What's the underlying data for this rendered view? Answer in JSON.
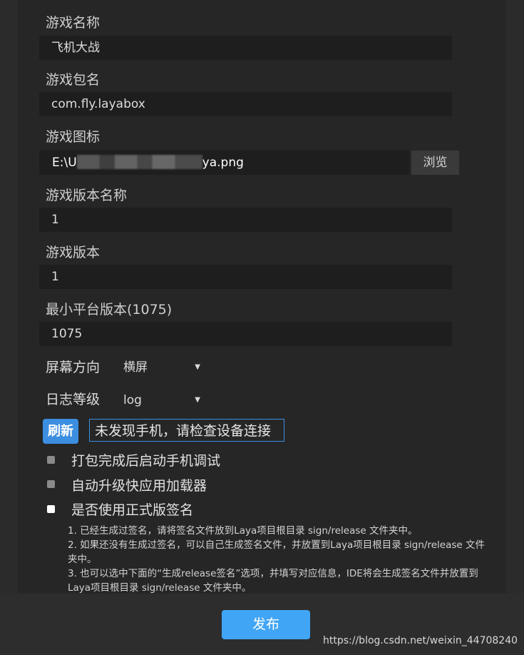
{
  "form": {
    "game_name": {
      "label": "游戏名称",
      "value": "飞机大战"
    },
    "package_name": {
      "label": "游戏包名",
      "value": "com.fly.layabox"
    },
    "game_icon": {
      "label": "游戏图标",
      "value_prefix": "E:\\U",
      "value_suffix": "ya.png",
      "browse_label": "浏览"
    },
    "version_name": {
      "label": "游戏版本名称",
      "value": "1"
    },
    "version_code": {
      "label": "游戏版本",
      "value": "1"
    },
    "min_platform_version": {
      "label": "最小平台版本(1075)",
      "value": "1075"
    },
    "orientation": {
      "label": "屏幕方向",
      "selected": "横屏"
    },
    "log_level": {
      "label": "日志等级",
      "selected": "log"
    }
  },
  "device": {
    "refresh_label": "刷新",
    "status": "未发现手机，请检查设备连接"
  },
  "options": [
    {
      "label": "打包完成后启动手机调试",
      "checked": false,
      "disabled": true
    },
    {
      "label": "自动升级快应用加载器",
      "checked": false,
      "disabled": true
    },
    {
      "label": "是否使用正式版签名",
      "checked": false,
      "disabled": false
    }
  ],
  "signature_notes": [
    "1. 已经生成过签名，请将签名文件放到Laya项目根目录 sign/release 文件夹中。",
    "2. 如果还没有生成过签名，可以自己生成签名文件，并放置到Laya项目根目录 sign/release 文件夹中。",
    "3. 也可以选中下面的“生成release签名”选项，并填写对应信息，IDE将会生成签名文件并放置到Laya项目根目录 sign/release 文件夹中。"
  ],
  "footer": {
    "publish_label": "发布",
    "watermark": "https://blog.csdn.net/weixin_44708240"
  },
  "colors": {
    "accent": "#3c8ee0",
    "publish_button": "#41a5f5",
    "panel_bg": "#262626",
    "field_bg": "#1e1e1e"
  },
  "icons": {
    "dropdown": "caret-down-icon"
  }
}
